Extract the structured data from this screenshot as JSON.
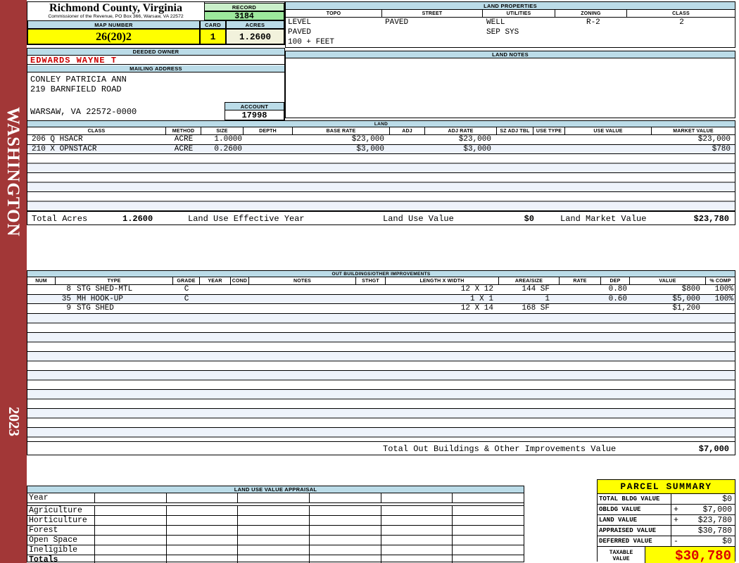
{
  "sidebar": {
    "state": "WASHINGTON",
    "year": "2023"
  },
  "header": {
    "title": "Richmond County, Virginia",
    "subtitle": "Commissioner of the Revenue, PO Box 366, Warsaw, VA 22572",
    "record_label": "RECORD",
    "record_value": "3184",
    "map_label": "MAP NUMBER",
    "map_value": "26(20)2",
    "card_label": "CARD",
    "card_value": "1",
    "acres_label": "ACRES",
    "acres_value": "1.2600"
  },
  "land_properties": {
    "title": "LAND PROPERTIES",
    "columns": [
      "TOPO",
      "STREET",
      "UTILITIES",
      "ZONING",
      "CLASS"
    ],
    "rows": [
      [
        "LEVEL",
        "PAVED",
        "WELL",
        "R-2",
        "2"
      ],
      [
        "PAVED",
        "",
        "SEP SYS",
        "",
        ""
      ],
      [
        "100 + FEET",
        "",
        "",
        "",
        ""
      ]
    ]
  },
  "owner": {
    "deeded_label": "DEEDED OWNER",
    "name": "EDWARDS WAYNE T",
    "mailing_label": "MAILING ADDRESS",
    "address_line1": "CONLEY PATRICIA ANN",
    "address_line2": "219 BARNFIELD ROAD",
    "address_line3": "WARSAW, VA 22572-0000",
    "account_label": "ACCOUNT",
    "account_value": "17998"
  },
  "land_notes": {
    "title": "LAND NOTES"
  },
  "land": {
    "title": "LAND",
    "columns": [
      "CLASS",
      "METHOD",
      "SIZE",
      "DEPTH",
      "BASE RATE",
      "ADJ",
      "ADJ RATE",
      "SZ ADJ TBL",
      "USE TYPE",
      "USE VALUE",
      "MARKET VALUE"
    ],
    "rows": [
      {
        "class": "206 Q HSACR",
        "method": "ACRE",
        "size": "1.0000",
        "depth": "",
        "base_rate": "$23,000",
        "adj": "",
        "adj_rate": "$23,000",
        "sz_adj_tbl": "",
        "use_type": "",
        "use_value": "",
        "market_value": "$23,000"
      },
      {
        "class": "210 X OPNSTACR",
        "method": "ACRE",
        "size": "0.2600",
        "depth": "",
        "base_rate": "$3,000",
        "adj": "",
        "adj_rate": "$3,000",
        "sz_adj_tbl": "",
        "use_type": "",
        "use_value": "",
        "market_value": "$780"
      }
    ],
    "totals": {
      "total_acres_label": "Total Acres",
      "total_acres": "1.2600",
      "effective_year_label": "Land Use Effective Year",
      "land_use_value_label": "Land Use Value",
      "land_use_value": "$0",
      "land_market_value_label": "Land Market Value",
      "land_market_value": "$23,780"
    }
  },
  "out_buildings": {
    "title": "OUT BUILDINGS/OTHER IMPROVEMENTS",
    "columns": [
      "NUM",
      "TYPE",
      "GRADE",
      "YEAR",
      "COND",
      "NOTES",
      "STHGT",
      "LENGTH X WIDTH",
      "AREA/SIZE",
      "RATE",
      "DEP",
      "VALUE",
      "% COMP"
    ],
    "rows": [
      {
        "num": "8",
        "type": "STG SHED-MTL",
        "grade": "C",
        "year": "",
        "cond": "",
        "notes": "",
        "sthgt": "",
        "lxw": "12 X 12",
        "area": "144 SF",
        "rate": "",
        "dep": "0.80",
        "value": "$800",
        "comp": "100%"
      },
      {
        "num": "35",
        "type": "MH HOOK-UP",
        "grade": "C",
        "year": "",
        "cond": "",
        "notes": "",
        "sthgt": "",
        "lxw": "1 X 1",
        "area": "1",
        "rate": "",
        "dep": "0.60",
        "value": "$5,000",
        "comp": "100%"
      },
      {
        "num": "9",
        "type": "STG SHED",
        "grade": "",
        "year": "",
        "cond": "",
        "notes": "",
        "sthgt": "",
        "lxw": "12 X 14",
        "area": "168 SF",
        "rate": "",
        "dep": "",
        "value": "$1,200",
        "comp": ""
      }
    ],
    "total_label": "Total Out Buildings & Other Improvements Value",
    "total_value": "$7,000"
  },
  "land_use_appraisal": {
    "title": "LAND USE VALUE APPRAISAL",
    "row_labels": [
      "Year",
      "Agriculture",
      "Horticulture",
      "Forest",
      "Open Space",
      "Ineligible",
      "Totals"
    ]
  },
  "parcel_summary": {
    "title": "PARCEL SUMMARY",
    "rows": [
      {
        "label": "TOTAL BLDG VALUE",
        "op": "",
        "value": "$0"
      },
      {
        "label": "OBLDG VALUE",
        "op": "+",
        "value": "$7,000"
      },
      {
        "label": "LAND VALUE",
        "op": "+",
        "value": "$23,780"
      },
      {
        "label": "APPRAISED VALUE",
        "op": "",
        "value": "$30,780"
      },
      {
        "label": "DEFERRED VALUE",
        "op": "-",
        "value": "$0"
      }
    ],
    "taxable_label_line1": "TAXABLE",
    "taxable_label_line2": "VALUE",
    "taxable_value": "$30,780"
  },
  "colors": {
    "sidebar_red": "#A23737",
    "header_blue": "#BBDCE8",
    "record_green": "#9DE89D",
    "highlight_yellow": "#FFFF00",
    "acres_cream": "#F2F2DC",
    "owner_red": "#CC0000",
    "taxable_red": "#DD0000",
    "row_stripe": "#EEF3FB"
  }
}
